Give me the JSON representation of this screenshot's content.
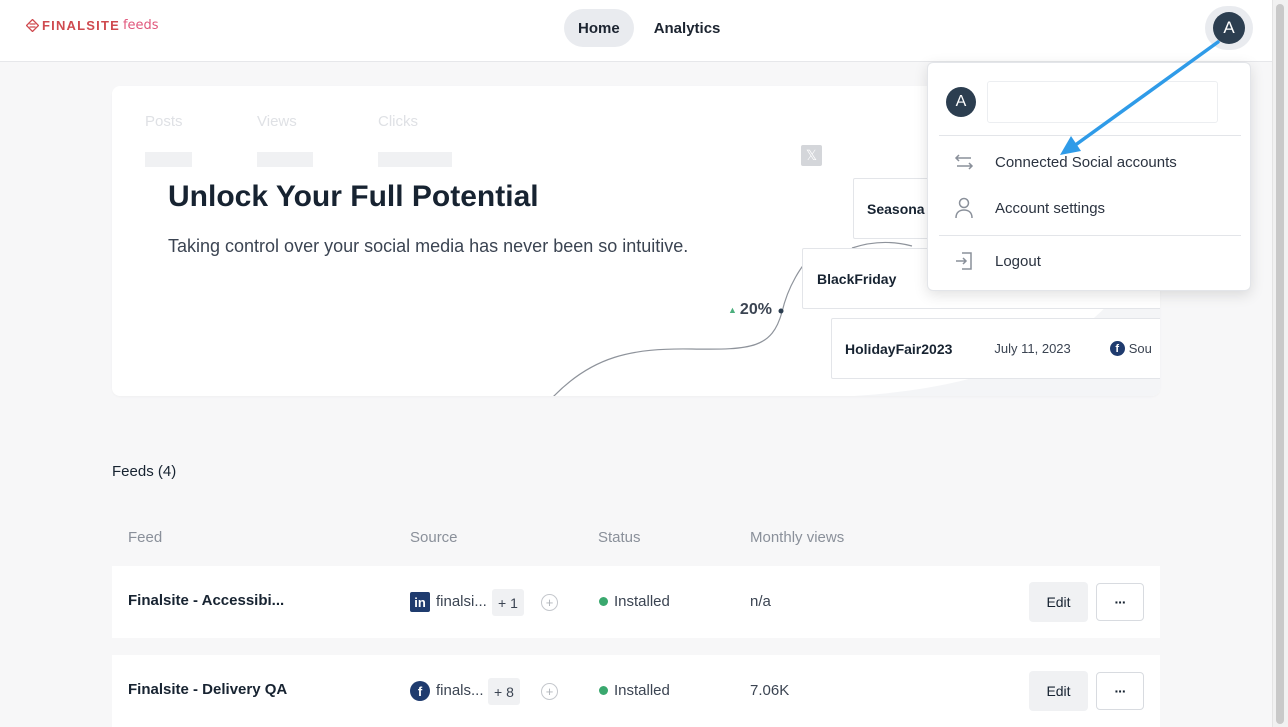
{
  "header": {
    "brand_name": "FINALSITE",
    "brand_suffix": "feeds",
    "nav": [
      {
        "label": "Home",
        "active": true
      },
      {
        "label": "Analytics",
        "active": false
      }
    ],
    "avatar_initial": "A"
  },
  "promo": {
    "stats": [
      "Posts",
      "Views",
      "Clicks"
    ],
    "title": "Unlock Your Full Potential",
    "subtitle": "Taking control over your social media has never been so intuitive.",
    "x_badge": "𝕏",
    "percent_change": "20%",
    "cards": [
      {
        "name": "Seasona"
      },
      {
        "name": "BlackFriday"
      },
      {
        "name": "HolidayFair2023",
        "date": "July 11, 2023",
        "source": "Sou"
      }
    ]
  },
  "feeds": {
    "title": "Feeds (4)",
    "columns": [
      "Feed",
      "Source",
      "Status",
      "Monthly views"
    ],
    "rows": [
      {
        "name": "Finalsite - Accessibi...",
        "source_icon": "linkedin-icon",
        "source_name": "finalsi...",
        "source_more": "+ 1",
        "status": "Installed",
        "views": "n/a",
        "edit": "Edit",
        "more": "···"
      },
      {
        "name": "Finalsite - Delivery QA",
        "source_icon": "facebook-icon",
        "source_name": "finals...",
        "source_more": "+ 8",
        "status": "Installed",
        "views": "7.06K",
        "edit": "Edit",
        "more": "···"
      }
    ]
  },
  "dropdown": {
    "avatar_initial": "A",
    "items": [
      {
        "label": "Connected Social accounts",
        "icon": "swap-arrows-icon"
      },
      {
        "label": "Account settings",
        "icon": "user-icon"
      },
      {
        "label": "Logout",
        "icon": "logout-icon"
      }
    ]
  },
  "colors": {
    "brand": "#cf4a4f",
    "avatar": "#2c3e50",
    "status_installed": "#3aa86e",
    "annotation_arrow": "#2f9be8"
  }
}
